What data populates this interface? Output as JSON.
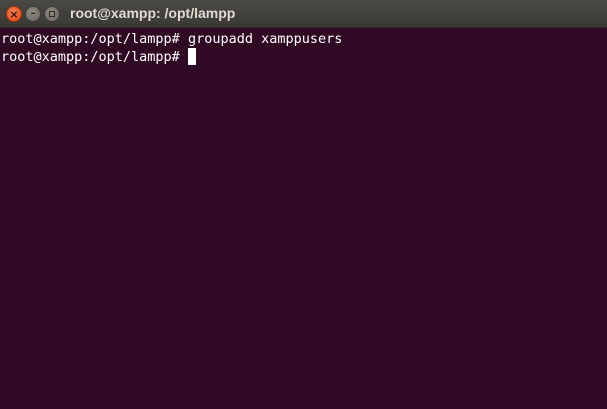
{
  "window": {
    "title": "root@xampp: /opt/lampp",
    "close_glyph": "×",
    "minimize_glyph": "–"
  },
  "terminal": {
    "lines": [
      {
        "prompt": "root@xampp:/opt/lampp# ",
        "command": "groupadd xamppusers"
      },
      {
        "prompt": "root@xampp:/opt/lampp# ",
        "command": ""
      }
    ]
  },
  "colors": {
    "background": "#300a24",
    "foreground": "#ffffff",
    "close_button": "#df4a16",
    "titlebar": "#3c3b37"
  },
  "icons": {
    "close": "close-icon",
    "minimize": "minimize-icon",
    "maximize": "maximize-icon"
  }
}
